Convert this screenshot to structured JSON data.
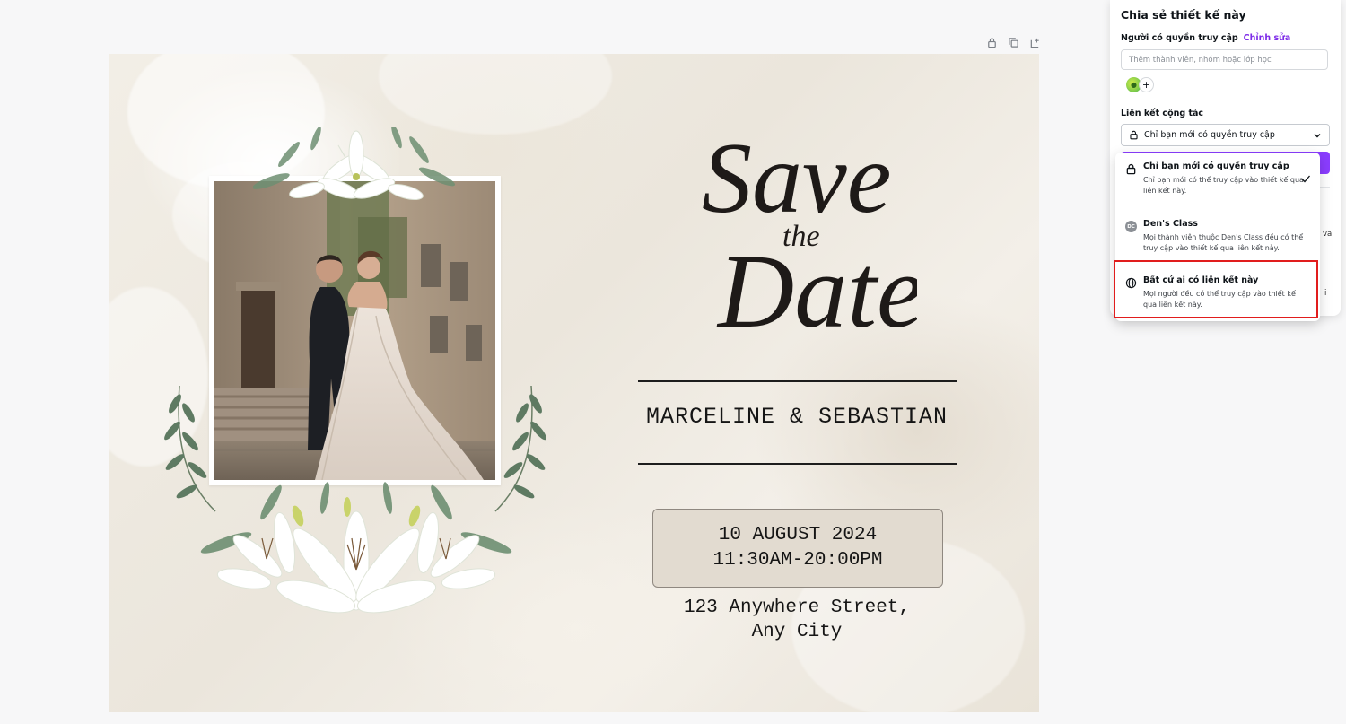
{
  "canvas_toolbar": {
    "lock_icon": "lock-icon",
    "duplicate_icon": "duplicate-icon",
    "add_page_icon": "add-page-icon"
  },
  "design": {
    "title_line1": "Save",
    "title_line2": "the",
    "title_line3": "Date",
    "names": "MARCELINE & SEBASTIAN",
    "date": "10 AUGUST 2024",
    "time": "11:30AM-20:00PM",
    "address_line1": "123 Anywhere Street,",
    "address_line2": "Any City"
  },
  "share_panel": {
    "title": "Chia sẻ thiết kế này",
    "access_label": "Người có quyền truy cập",
    "edit_link": "Chỉnh sửa",
    "member_input_placeholder": "Thêm thành viên, nhóm hoặc lớp học",
    "add_member": "+",
    "collab_label": "Liên kết cộng tác",
    "collab_selected": "Chỉ bạn mới có quyền truy cập",
    "peek_right_1": "va",
    "peek_right_2": "i"
  },
  "dropdown": {
    "options": [
      {
        "title": "Chỉ bạn mới có quyền truy cập",
        "desc": "Chỉ bạn mới có thể truy cập vào thiết kế qua liên kết này.",
        "icon": "lock-icon",
        "selected": true
      },
      {
        "title": "Den's Class",
        "desc": "Mọi thành viên thuộc Den's Class đều có thể truy cập vào thiết kế qua liên kết này.",
        "icon": "team-badge",
        "badge": "DC",
        "selected": false
      },
      {
        "title": "Bất cứ ai có liên kết này",
        "desc": "Mọi người đều có thể truy cập vào thiết kế qua liên kết này.",
        "icon": "globe-icon",
        "selected": false
      }
    ]
  },
  "colors": {
    "brand_purple": "#8b3dff",
    "edit_link": "#7d2ae8",
    "highlight_red": "#e11d1d"
  }
}
